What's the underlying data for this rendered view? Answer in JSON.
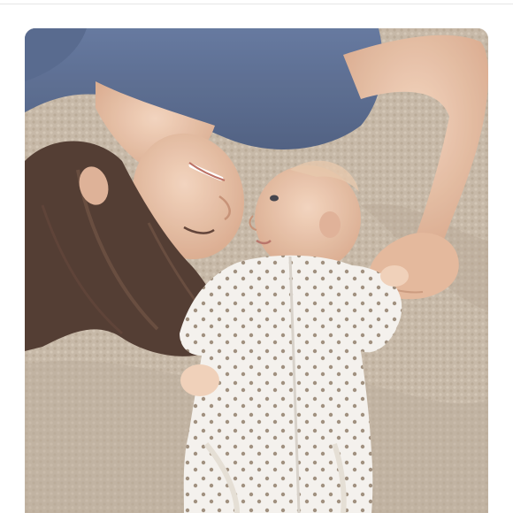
{
  "photo": {
    "alt": "",
    "colors": {
      "blanket": "#c4b5a3",
      "shirt": "#55698f",
      "skin": "#e8c2a6",
      "hair": "#4a3228",
      "onesie": "#f4f1ec",
      "dots": "#9b8a77"
    }
  }
}
